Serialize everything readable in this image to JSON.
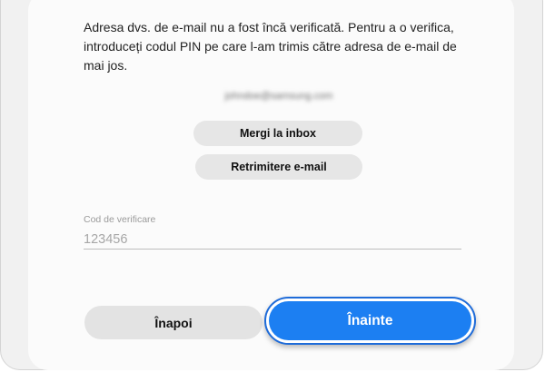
{
  "verification": {
    "message": "Adresa dvs. de e-mail nu a fost încă verificată. Pentru a o verifica, introduceți codul PIN pe care l-am trimis către adresa de e-mail de mai jos.",
    "email": "johndoe@samsung.com"
  },
  "actions": {
    "inbox_label": "Mergi la inbox",
    "resend_label": "Retrimitere e-mail"
  },
  "code_field": {
    "label": "Cod de verificare",
    "placeholder": "123456",
    "value": ""
  },
  "footer": {
    "back_label": "Înapoi",
    "next_label": "Înainte"
  },
  "colors": {
    "primary": "#1c7ff2",
    "secondary_button": "#e3e3e3"
  }
}
